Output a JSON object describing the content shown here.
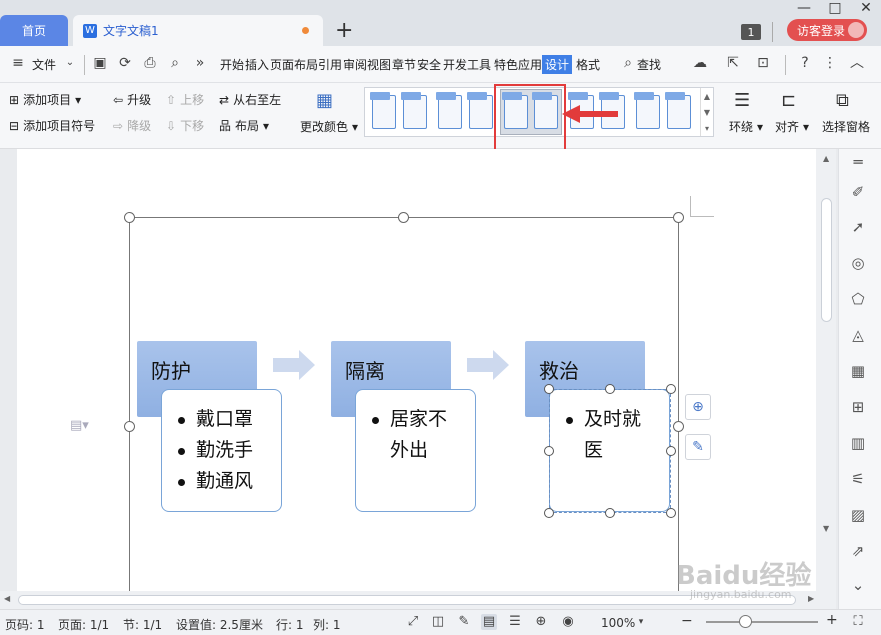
{
  "tabs": {
    "home": "首页",
    "doc": "文字文稿1",
    "doc_icon": "W",
    "add": "+"
  },
  "window": {
    "badge": "1",
    "login": "访客登录",
    "min": "—",
    "max": "□",
    "close": "✕"
  },
  "menu": {
    "file": "文件",
    "items": [
      "开始",
      "插入",
      "页面布局",
      "引用",
      "审阅",
      "视图",
      "章节",
      "安全",
      "开发工具",
      "特色应用"
    ],
    "design": "设计",
    "format": "格式",
    "search": "查找",
    "help": "?",
    "more": "⋮",
    "collapse": "︿"
  },
  "ribbon": {
    "add_item": "添加项目",
    "add_bullet": "添加项目符号",
    "promote": "升级",
    "demote": "降级",
    "move_up": "上移",
    "move_down": "下移",
    "rtl": "从右至左",
    "layout": "布局",
    "change_color": "更改颜色",
    "wrap": "环绕",
    "align": "对齐",
    "select_pane": "选择窗格"
  },
  "smartart": {
    "columns": [
      {
        "header": "防护",
        "bullets": [
          "戴口罩",
          "勤洗手",
          "勤通风"
        ]
      },
      {
        "header": "隔离",
        "bullets": [
          "居家不外出"
        ]
      },
      {
        "header": "救治",
        "bullets": [
          "及时就医"
        ]
      }
    ]
  },
  "status": {
    "page_code": "页码: 1",
    "pages": "页面: 1/1",
    "section": "节: 1/1",
    "setting": "设置值: 2.5厘米",
    "row": "行: 1",
    "col": "列: 1",
    "zoom": "100%",
    "zoom_minus": "−",
    "zoom_plus": "+"
  },
  "watermark": {
    "main": "Baidu经验",
    "sub": "jingyan.baidu.com"
  },
  "colors": {
    "accent": "#3f7fe6",
    "home_tab": "#5b86e5",
    "login": "#e35050",
    "highlight": "#e23b3b",
    "smartart_header": "#8fb0e2"
  }
}
